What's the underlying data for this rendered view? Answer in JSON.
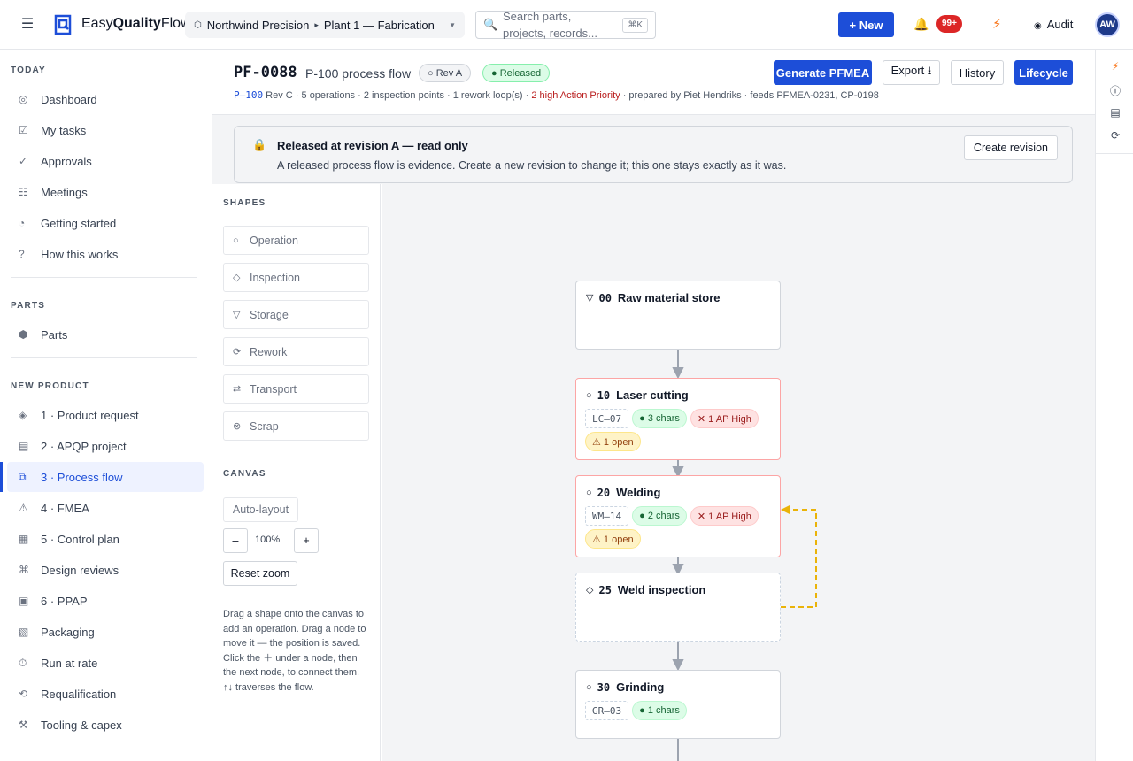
{
  "brand": {
    "name_light": "Easy",
    "name_bold": "Quality",
    "name_end": "Flow"
  },
  "header": {
    "plant": "Northwind Precision",
    "site": "Plant 1 — Fabrication",
    "search_placeholder": "Search parts, projects, records...",
    "search_kbd": "⌘K",
    "new_label": "+ New",
    "notif_count": "99+",
    "audit_label": "Audit",
    "avatar": "AW"
  },
  "sidebar": {
    "today_head": "TODAY",
    "today": [
      {
        "icon": "◎",
        "label": "Dashboard"
      },
      {
        "icon": "☑",
        "label": "My tasks"
      },
      {
        "icon": "✓",
        "label": "Approvals"
      },
      {
        "icon": "☷",
        "label": "Meetings"
      },
      {
        "icon": "◔",
        "label": "Getting started"
      },
      {
        "icon": "?",
        "label": "How this works"
      }
    ],
    "parts_head": "PARTS",
    "parts": [
      {
        "icon": "⬢",
        "label": "Parts"
      }
    ],
    "np_head": "NEW PRODUCT",
    "new_product": [
      {
        "icon": "◈",
        "label": "1 · Product request"
      },
      {
        "icon": "▤",
        "label": "2 · APQP project"
      },
      {
        "icon": "⧉",
        "label": "3 · Process flow"
      },
      {
        "icon": "⚠",
        "label": "4 · FMEA"
      },
      {
        "icon": "▦",
        "label": "5 · Control plan"
      },
      {
        "icon": "⌘",
        "label": "Design reviews"
      },
      {
        "icon": "▣",
        "label": "6 · PPAP"
      },
      {
        "icon": "▧",
        "label": "Packaging"
      },
      {
        "icon": "⏱",
        "label": "Run at rate"
      },
      {
        "icon": "⟲",
        "label": "Requalification"
      },
      {
        "icon": "⚒",
        "label": "Tooling & capex"
      }
    ]
  },
  "page": {
    "id": "PF-0088",
    "name": "P-100 process flow",
    "rev_pill": "○ Rev A",
    "status_pill": "● Released",
    "sub_part": "P–100",
    "sub_a": " Rev C · 5 operations · 2 inspection points · 1 rework loop(s) · ",
    "sub_red": "2 high Action Priority",
    "sub_b": " · prepared by Piet Hendriks · feeds PFMEA-0231, CP-0198",
    "btn_generate": "Generate PFMEA",
    "btn_export": "Export ⭳",
    "btn_history": "History",
    "btn_lifecycle": "Lifecycle"
  },
  "banner": {
    "title": "Released at revision A — read only",
    "text": "A released process flow is evidence. Create a new revision to change it; this one stays exactly as it was.",
    "button": "Create revision"
  },
  "shapes_panel": {
    "head": "SHAPES",
    "items": [
      {
        "icon": "○",
        "label": "Operation"
      },
      {
        "icon": "◇",
        "label": "Inspection"
      },
      {
        "icon": "▽",
        "label": "Storage"
      },
      {
        "icon": "⟳",
        "label": "Rework"
      },
      {
        "icon": "⇄",
        "label": "Transport"
      },
      {
        "icon": "⊗",
        "label": "Scrap"
      }
    ],
    "canvas_head": "CANVAS",
    "auto_layout": "Auto-layout",
    "zoom_out": "–",
    "zoom": "100%",
    "zoom_in": "+",
    "reset_zoom": "Reset zoom",
    "help": "Drag a shape onto the canvas to add an operation. Drag a node to move it — the position is saved. Click the ＋ under a node, then the next node, to connect them. ↑↓ traverses the flow."
  },
  "flow": {
    "nodes": [
      {
        "sym": "▽",
        "num": "00",
        "title": "Raw material store",
        "chips": []
      },
      {
        "sym": "○",
        "num": "10",
        "title": "Laser cutting",
        "chips": [
          {
            "kind": "code",
            "text": "LC–07"
          },
          {
            "kind": "green",
            "text": "● 3 chars"
          },
          {
            "kind": "red",
            "text": "✕ 1 AP High"
          },
          {
            "kind": "amber",
            "text": "⚠ 1 open"
          }
        ]
      },
      {
        "sym": "○",
        "num": "20",
        "title": "Welding",
        "chips": [
          {
            "kind": "code",
            "text": "WM–14"
          },
          {
            "kind": "green",
            "text": "● 2 chars"
          },
          {
            "kind": "red",
            "text": "✕ 1 AP High"
          },
          {
            "kind": "amber",
            "text": "⚠ 1 open"
          }
        ]
      },
      {
        "sym": "◇",
        "num": "25",
        "title": "Weld inspection",
        "chips": []
      },
      {
        "sym": "○",
        "num": "30",
        "title": "Grinding",
        "chips": [
          {
            "kind": "code",
            "text": "GR–03"
          },
          {
            "kind": "green",
            "text": "● 1 chars"
          }
        ]
      }
    ]
  },
  "colors": {
    "accent": "#1d4ed8",
    "rework_loop": "#eab308",
    "risk_border": "#fca5a5"
  }
}
